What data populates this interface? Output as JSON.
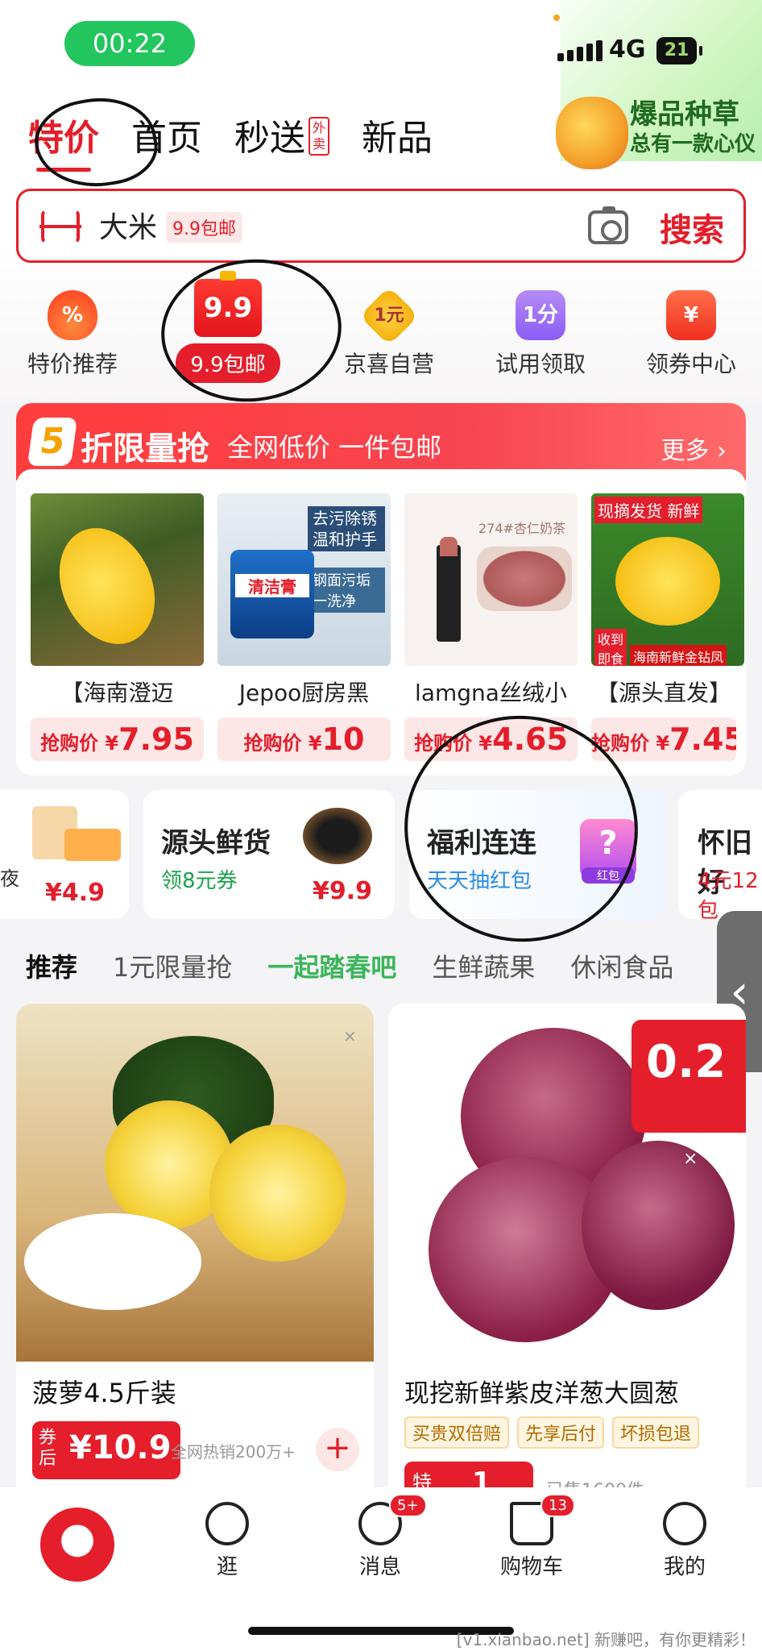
{
  "status_bar": {
    "time": "00:22",
    "network": "4G",
    "battery": "21"
  },
  "top_tabs": [
    {
      "label": "特价",
      "active": true
    },
    {
      "label": "首页"
    },
    {
      "label": "秒送",
      "tag": "外卖"
    },
    {
      "label": "新品"
    }
  ],
  "promo": {
    "title": "爆品种草",
    "subtitle": "总有一款心仪"
  },
  "search": {
    "keyword": "大米",
    "tag": "9.9包邮",
    "button": "搜索"
  },
  "quick_icons": [
    {
      "label": "特价推荐",
      "glyph": "%"
    },
    {
      "label": "9.9包邮",
      "glyph": "9.9"
    },
    {
      "label": "京喜自营",
      "glyph": "1元"
    },
    {
      "label": "试用领取",
      "glyph": "1分"
    },
    {
      "label": "领券中心",
      "glyph": "¥"
    }
  ],
  "flash_sale": {
    "badge": "5",
    "title": "折限量抢",
    "subtitle": "全网低价 一件包邮",
    "more": "更多 ›",
    "items": [
      {
        "name": "【海南澄迈",
        "price_prefix": "抢购价 ¥",
        "price": "7.95",
        "image_text": ""
      },
      {
        "name": "Jepoo厨房黑",
        "price_prefix": "抢购价 ¥",
        "price": "10",
        "image_text": "去污除锈 温和护手",
        "image_sub": "钢面污垢 一洗净",
        "image_label": "清洁膏"
      },
      {
        "name": "lamgna丝绒小",
        "price_prefix": "抢购价 ¥",
        "price": "4.65",
        "image_text": "274#杏仁奶茶"
      },
      {
        "name": "【源头直发】",
        "price_prefix": "抢购价 ¥",
        "price": "7.45",
        "image_text": "现摘发货 新鲜",
        "image_sub": "海南新鲜金钻凤",
        "image_tag": "收到即食"
      }
    ]
  },
  "mini_cards": [
    {
      "title": "",
      "sub": "夜",
      "price": "¥4.9"
    },
    {
      "title": "源头鲜货",
      "sub": "领8元券",
      "price": "¥9.9"
    },
    {
      "title": "福利连连",
      "sub": "天天抽红包",
      "tag": "红包"
    },
    {
      "title": "怀旧好",
      "sub": "4元12包"
    }
  ],
  "categories": [
    {
      "label": "推荐",
      "selected": true
    },
    {
      "label": "1元限量抢"
    },
    {
      "label": "一起踏春吧",
      "highlight": true
    },
    {
      "label": "生鲜蔬果"
    },
    {
      "label": "休闲食品"
    }
  ],
  "products": [
    {
      "name": "菠萝4.5斤装",
      "badge": "券后",
      "price": "¥10.9",
      "sales": "全网热销200万+",
      "add": "+"
    },
    {
      "name": "现挖新鲜紫皮洋葱大圆葱",
      "tags": [
        "买贵双倍赔",
        "先享后付",
        "坏损包退"
      ],
      "corner_price": "0.2",
      "badge": "特",
      "price": "1",
      "sales": "已售1600件"
    }
  ],
  "bottom_nav": [
    {
      "label": "",
      "icon": "home-mascot-icon"
    },
    {
      "label": "逛",
      "icon": "browse-icon"
    },
    {
      "label": "消息",
      "icon": "message-icon",
      "badge": "5+"
    },
    {
      "label": "购物车",
      "icon": "cart-icon",
      "badge": "13"
    },
    {
      "label": "我的",
      "icon": "profile-icon"
    }
  ],
  "watermark": "[v1.xianbao.net] 新赚吧，有你更精彩！",
  "colors": {
    "accent": "#e41e2b",
    "green": "#3bb55a",
    "status_green": "#22c55e"
  }
}
